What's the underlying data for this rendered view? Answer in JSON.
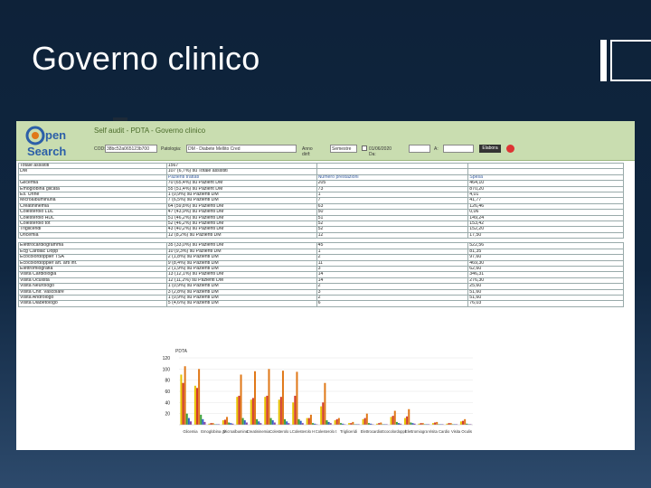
{
  "slide": {
    "title": "Governo clinico"
  },
  "app": {
    "title": "Self audit - PDTA - Governo clinico",
    "logo": "Open Search",
    "filters": {
      "cod_label": "COD:",
      "cod_value": "38bc52a065123b700",
      "patologia_label": "Patologia:",
      "patologia_value": "DM - Diabete Mellito Cred",
      "anno_label": "Anno dirif:",
      "anno_value": "Semestre",
      "checkbox_label": "01/06/2020 Da:",
      "a_label": "A:",
      "button": "Elabora"
    }
  },
  "table": {
    "top_rows": [
      [
        "Totale assistiti",
        "1567",
        "",
        ""
      ],
      [
        "DM",
        "107 (6,7%) su Totale assistiti",
        "",
        ""
      ],
      [
        "",
        "Pazienti trattati",
        "Numero prestazioni",
        "Spesa"
      ],
      [
        "Glicemia",
        "70 (65,4%) su Pazient DM",
        "205",
        "464,10"
      ],
      [
        "Emoglobina glicata",
        "55 (51,4%) su Pazient DM",
        "73",
        "870,20"
      ],
      [
        "Es. Urine",
        "1 (0,9%) su Pazienti DM",
        "1",
        "4,01"
      ],
      [
        "Microalbuminuria",
        "7 (6,5%) su Pazienti DM",
        "7",
        "41,77"
      ],
      [
        "Creatininemia",
        "64 (59,8%) su Pazienti DM",
        "63",
        "126,46"
      ],
      [
        "Colesterolo LDL",
        "47 (43,9%) su Pazienti DM",
        "50",
        "0,06"
      ],
      [
        "Colesterolo HDL",
        "51 (46,2%) su Pazienti DM",
        "51",
        "149,24"
      ],
      [
        "Colesterolo tot",
        "52 (46,2%) su Pazienti DM",
        "52",
        "153,42"
      ],
      [
        "Trigliceridi",
        "43 (40,2%) su Pazienti DM",
        "52",
        "152,20"
      ],
      [
        "Uricemia",
        "12 (8,2%) su Pazienti DM",
        "12",
        "17,50"
      ]
    ],
    "bottom_rows": [
      [
        "Elettrocardiogramma",
        "35 (33,0%) su Pazienti DM",
        "45",
        "522,56"
      ],
      [
        "Ecg Cardiac Dopp",
        "10 (9,3%) su Pazienti DM",
        "1",
        "81,35"
      ],
      [
        "Ecocolordoppler TSA",
        "2 (1,8%) su Pazienti DM",
        "2",
        "97,60"
      ],
      [
        "Ecocolordoppler art. arti inf.",
        "9 (8,4%) su Pazienti DM",
        "11",
        "469,30"
      ],
      [
        "Elettromiografia",
        "2 (1,9%) su Pazienti DM",
        "3",
        "62,60"
      ],
      [
        "Visita Cardiologia",
        "13 (12,1%) su Pazienti DM",
        "14",
        "346,31"
      ],
      [
        "Visita Oculista",
        "12 (11,2%) su Pazienti DM",
        "14",
        "276,30"
      ],
      [
        "Visita Neurologo",
        "1 (0,9%) su Pazienti DM",
        "2",
        "25,60"
      ],
      [
        "Visita Chir. Vascolare",
        "3 (2,8%) su Pazienti DM",
        "3",
        "51,60"
      ],
      [
        "Visita Andrologo",
        "1 (0,9%) su Pazienti DM",
        "2",
        "51,60"
      ],
      [
        "Visita Diabetologo",
        "5 (4,6%) su Pazienti DM",
        "6",
        "76,03"
      ]
    ]
  },
  "chart_data": {
    "type": "bar",
    "title": "PDTA",
    "yticks": [
      "120",
      "100",
      "80",
      "60",
      "40",
      "20"
    ],
    "ylim": [
      0,
      120
    ],
    "categories": [
      "Glicemia",
      "Emoglobina glicata",
      "Es. Urine",
      "Microalbuminuria",
      "Creatininemia",
      "Colesterolo LDL",
      "Colesterolo HDL",
      "Colesterolo tot",
      "Trigliceridi",
      "Uricemia",
      "Elettrocardiogramma",
      "Ecg Cardiac Dopp",
      "Ecocolordoppler TSA",
      "Ecocolordoppler art. arti inf.",
      "Elettromiografia",
      "Visita Cardiologia",
      "Visita Oculista",
      "Visita Neurologo",
      "Visita Chir. Vascolare",
      "Visita Andrologo",
      "Visita Diabetologo"
    ],
    "xtick_labels": [
      "Glicemia",
      "Emoglobina glicata",
      "Microalbuminuria",
      "Creatininemia",
      "Colesterolo LDL",
      "Colesterolo HDL",
      "Colesterolo tot",
      "Trigliceridi",
      "Elettrocardiogramma",
      "Ecocolordoppler TSA",
      "Elettromiografia",
      "Visita Cardiologia",
      "Visita Oculista"
    ],
    "series": [
      {
        "color": "#e8c400",
        "values": [
          90,
          70,
          2,
          8,
          50,
          45,
          50,
          45,
          40,
          12,
          33,
          8,
          3,
          10,
          2,
          14,
          12,
          2,
          3,
          2,
          6
        ]
      },
      {
        "color": "#d13a2a",
        "values": [
          75,
          66,
          3,
          9,
          52,
          48,
          52,
          50,
          52,
          12,
          40,
          10,
          3,
          12,
          3,
          16,
          15,
          3,
          4,
          3,
          7
        ]
      },
      {
        "color": "#e07818",
        "values": [
          105,
          100,
          3,
          14,
          90,
          96,
          100,
          97,
          95,
          18,
          75,
          12,
          5,
          20,
          4,
          25,
          28,
          3,
          5,
          3,
          10
        ]
      },
      {
        "color": "#3aa03a",
        "values": [
          20,
          18,
          1,
          4,
          12,
          10,
          12,
          10,
          10,
          3,
          8,
          3,
          1,
          3,
          1,
          5,
          4,
          1,
          1,
          1,
          2
        ]
      },
      {
        "color": "#3060c8",
        "values": [
          12,
          10,
          1,
          3,
          8,
          6,
          8,
          6,
          7,
          2,
          5,
          2,
          1,
          2,
          1,
          3,
          3,
          1,
          1,
          1,
          1
        ]
      },
      {
        "color": "#8844aa",
        "values": [
          6,
          5,
          1,
          2,
          4,
          3,
          4,
          3,
          3,
          1,
          3,
          1,
          1,
          1,
          1,
          2,
          2,
          1,
          1,
          1,
          1
        ]
      }
    ]
  }
}
